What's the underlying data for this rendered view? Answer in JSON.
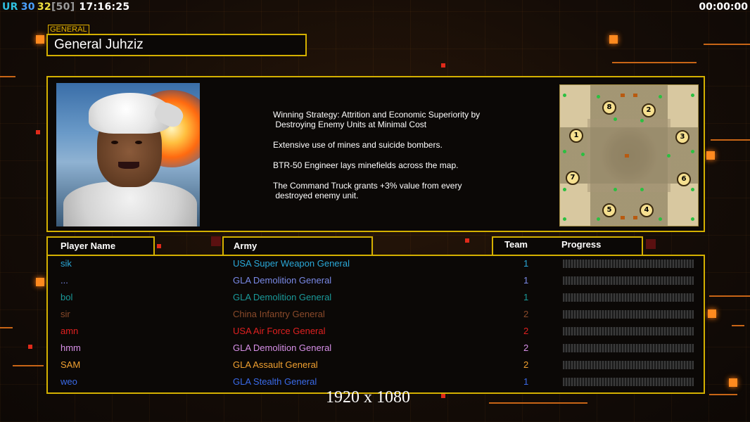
{
  "status": {
    "ur_label": "UR",
    "fps": "30",
    "fps_limit": "32",
    "fps_cap": "[50]",
    "clock": "17:16:25",
    "timer": "00:00:00"
  },
  "colors": {
    "ur": "#2fc0e0",
    "fps": "#4aa0ff",
    "fps_limit": "#f0e040",
    "fps_cap": "#9a9a9a",
    "panel_border": "#d4b000"
  },
  "general": {
    "tag": "GENERAL",
    "title": "General Juhziz",
    "portrait_icon": "general-portrait-image",
    "strategy": [
      "Winning Strategy: Attrition and Economic Superiority by\n Destroying Enemy Units at Minimal Cost",
      "Extensive use of mines and suicide bombers.",
      "BTR-50 Engineer lays minefields across the map.",
      "The Command Truck grants +3% value from every\n destroyed enemy unit."
    ]
  },
  "minimap": {
    "spawns": [
      "1",
      "2",
      "3",
      "4",
      "5",
      "6",
      "7",
      "8"
    ]
  },
  "table": {
    "headers": {
      "player": "Player Name",
      "army": "Army",
      "team": "Team",
      "progress": "Progress"
    },
    "rows": [
      {
        "name": "sik",
        "army": "USA Super Weapon General",
        "team": "1",
        "color": "#2aa8d8",
        "progress": 0
      },
      {
        "name": "...",
        "army": "GLA Demolition General",
        "team": "1",
        "color": "#7a8ae8",
        "progress": 0
      },
      {
        "name": "bol",
        "army": "GLA Demolition General",
        "team": "1",
        "color": "#1a9a9a",
        "progress": 0
      },
      {
        "name": "sir",
        "army": "China Infantry General",
        "team": "2",
        "color": "#8a4a2a",
        "progress": 0
      },
      {
        "name": "amn",
        "army": "USA Air Force General",
        "team": "2",
        "color": "#e02020",
        "progress": 0
      },
      {
        "name": "hmm",
        "army": "GLA Demolition General",
        "team": "2",
        "color": "#d890e8",
        "progress": 0
      },
      {
        "name": "SAM",
        "army": "GLA Assault General",
        "team": "2",
        "color": "#f0a030",
        "progress": 0
      },
      {
        "name": "weo",
        "army": "GLA Stealth General",
        "team": "1",
        "color": "#3a6ae8",
        "progress": 0
      }
    ]
  },
  "overlay": {
    "resolution": "1920 x 1080"
  }
}
